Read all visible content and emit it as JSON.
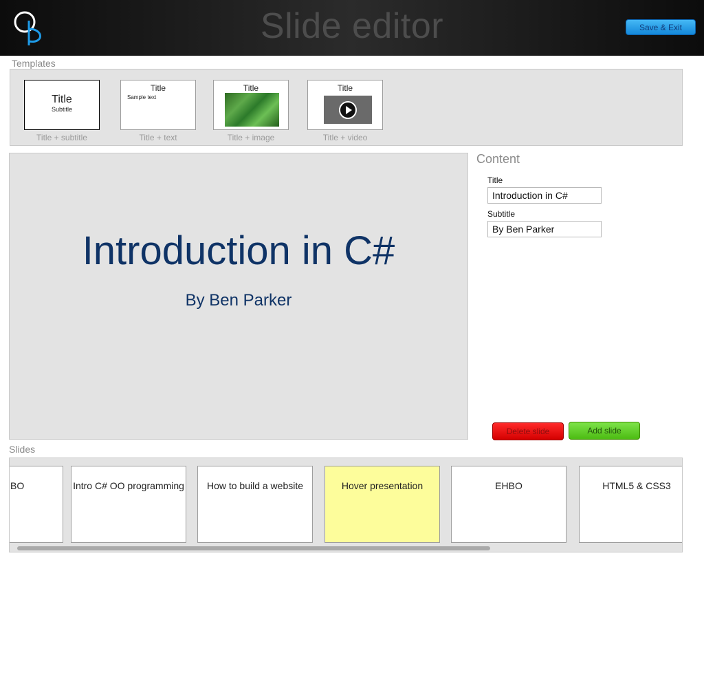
{
  "header": {
    "logo_letters": "OP",
    "title": "Slide editor",
    "save_exit_label": "Save & Exit"
  },
  "templates": {
    "label": "Templates",
    "items": [
      {
        "big": "Title",
        "small": "Subtitle",
        "caption": "Title + subtitle"
      },
      {
        "head": "Title",
        "text": "Sample text",
        "caption": "Title + text"
      },
      {
        "head": "Title",
        "caption": "Title + image"
      },
      {
        "head": "Title",
        "caption": "Title + video"
      }
    ]
  },
  "preview": {
    "title": "Introduction in C#",
    "subtitle": "By Ben Parker"
  },
  "content": {
    "heading": "Content",
    "title_label": "Title",
    "title_value": "Introduction in C#",
    "subtitle_label": "Subtitle",
    "subtitle_value": "By Ben Parker"
  },
  "actions": {
    "delete_label": "Delete slide",
    "add_label": "Add slide"
  },
  "slides": {
    "label": "Slides",
    "items": [
      {
        "label": "BO"
      },
      {
        "label": "Intro C# OO programming"
      },
      {
        "label": "How to build a website"
      },
      {
        "label": "Hover presentation"
      },
      {
        "label": "EHBO"
      },
      {
        "label": "HTML5 & CSS3"
      }
    ]
  },
  "colors": {
    "accent_blue": "#1488da",
    "delete_red": "#d40000",
    "add_green": "#4cbc12",
    "hover_yellow": "#fdfd9b",
    "preview_text": "#0f3366"
  }
}
